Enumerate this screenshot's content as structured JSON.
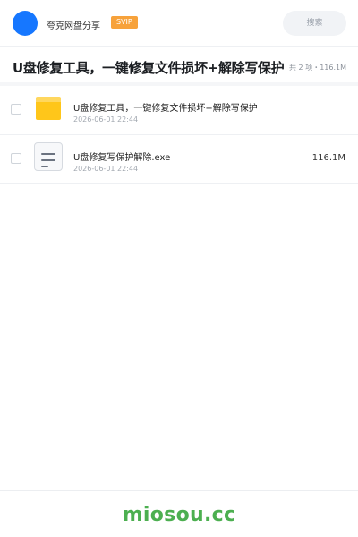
{
  "header": {
    "app_name": "夸克网盘分享",
    "vip_badge": "SVIP",
    "search_label": "搜索",
    "accent_color": "#1677ff"
  },
  "share": {
    "title": "U盘修复工具，一键修复文件损坏+解除写保护",
    "summary": "共 2 项・116.1M"
  },
  "files": [
    {
      "icon": "folder-icon",
      "name": "U盘修复工具，一键修复文件损坏+解除写保护",
      "date": "2026-06-01 22:44",
      "size": ""
    },
    {
      "icon": "file-icon",
      "name": "U盘修复写保护解除.exe",
      "date": "2026-06-01 22:44",
      "size": "116.1M"
    }
  ],
  "footer": {
    "watermark": "miosou.cc"
  }
}
